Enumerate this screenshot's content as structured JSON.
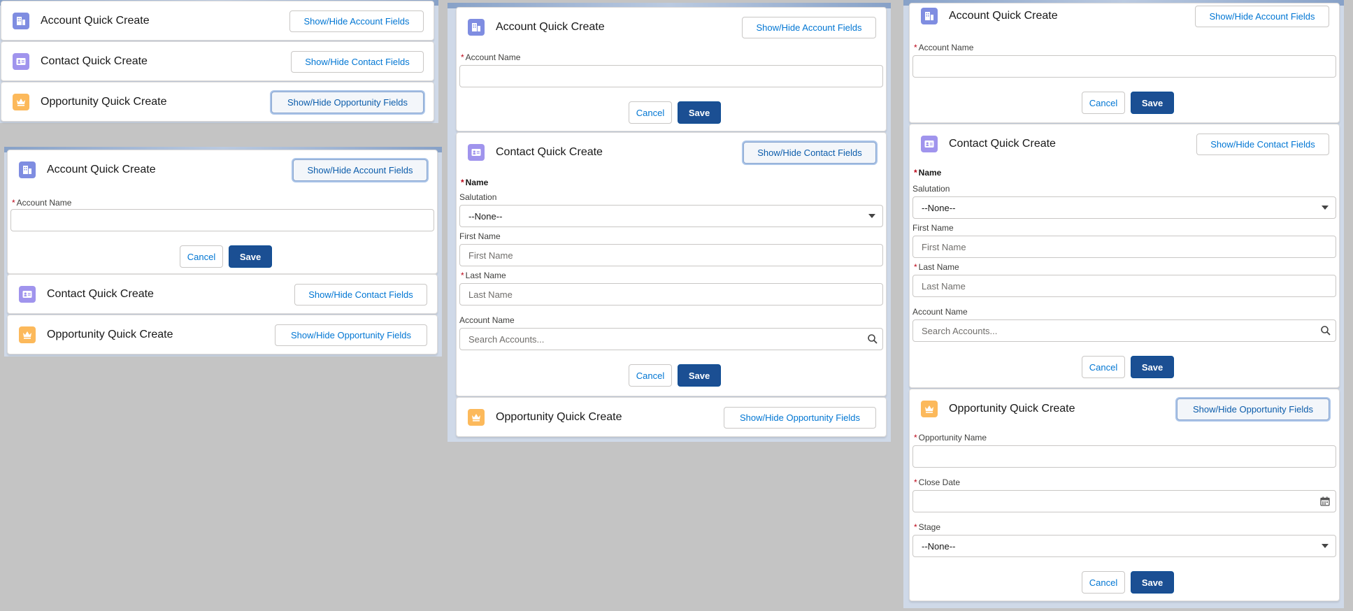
{
  "cards": {
    "account_title": "Account Quick Create",
    "contact_title": "Contact Quick Create",
    "opportunity_title": "Opportunity Quick Create"
  },
  "buttons": {
    "toggle_account": "Show/Hide Account Fields",
    "toggle_contact": "Show/Hide Contact Fields",
    "toggle_opportunity": "Show/Hide Opportunity Fields",
    "cancel": "Cancel",
    "save": "Save"
  },
  "fields": {
    "required_marker": "*",
    "account_name_label": "Account Name",
    "name_group_label": "Name",
    "salutation_label": "Salutation",
    "salutation_value": "--None--",
    "first_name_label": "First Name",
    "first_name_placeholder": "First Name",
    "last_name_label": "Last Name",
    "last_name_placeholder": "Last Name",
    "account_lookup_label": "Account Name",
    "account_lookup_placeholder": "Search Accounts...",
    "opportunity_name_label": "Opportunity Name",
    "close_date_label": "Close Date",
    "stage_label": "Stage",
    "stage_value": "--None--"
  },
  "icons": {
    "account": "account-building-icon",
    "contact": "contact-card-icon",
    "opportunity": "opportunity-crown-icon",
    "search": "search-icon",
    "calendar": "calendar-icon",
    "dropdown": "chevron-down-icon"
  },
  "colors": {
    "account_icon": "#7f8de1",
    "contact_icon": "#a094ed",
    "opportunity_icon": "#fcb95b",
    "save_button": "#1b4f93",
    "link_text": "#0176d3",
    "required": "#ba0517"
  }
}
